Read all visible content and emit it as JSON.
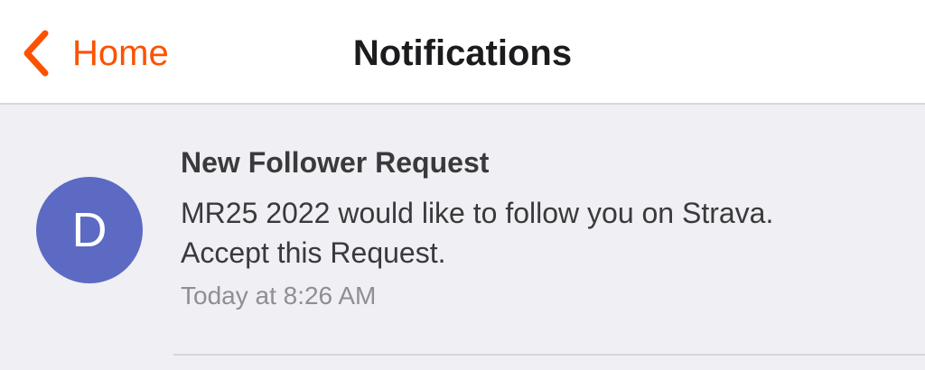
{
  "header": {
    "back_label": "Home",
    "title": "Notifications",
    "back_icon": "chevron-left-icon"
  },
  "notifications": [
    {
      "avatar_letter": "D",
      "title": "New Follower Request",
      "body_line1": "MR25 2022 would like to follow you on Strava.",
      "body_line2": "Accept this Request.",
      "time": "Today at 8:26 AM"
    }
  ],
  "colors": {
    "accent": "#fc5200",
    "avatar": "#5c6ac4",
    "content_background": "#efeff4"
  }
}
